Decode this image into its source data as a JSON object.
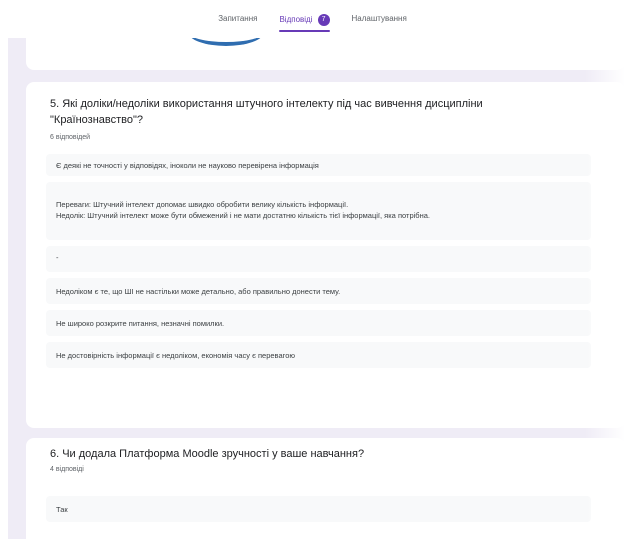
{
  "tabs": [
    {
      "label": "Запитання"
    },
    {
      "label": "Відповіді",
      "badge": "7"
    },
    {
      "label": "Налаштування"
    }
  ],
  "questions": [
    {
      "title": "5. Які доліки/недоліки використання штучного інтелекту під час вивчення дисципліни \"Країнознавство\"?",
      "count": "6 відповідей",
      "answers": [
        "Є деякі не точності у відповідях, іноколи не науково перевірена інформація",
        "Переваги: Штучний інтелект допомає швидко обробити велику кількість інформації.\nНедолік: Штучний інтелект може бути обмежений і не мати достатню кількість тієї інформації, яка потрібна.",
        "-",
        "Недоліком є те, що ШІ не настільки може детально, або правильно донести тему.",
        "Не широко розкрите питання, незначні помилки.",
        "Не достовірність інформації є недоліком, економія часу є перевагою"
      ]
    },
    {
      "title": "6. Чи додала Платформа Moodle зручності у ваше навчання?",
      "count": "4 відповіді",
      "answers": [
        "Так"
      ]
    }
  ],
  "colors": {
    "accent": "#673ab7",
    "background": "#efecf6",
    "header_arc": "#2f6db0"
  }
}
